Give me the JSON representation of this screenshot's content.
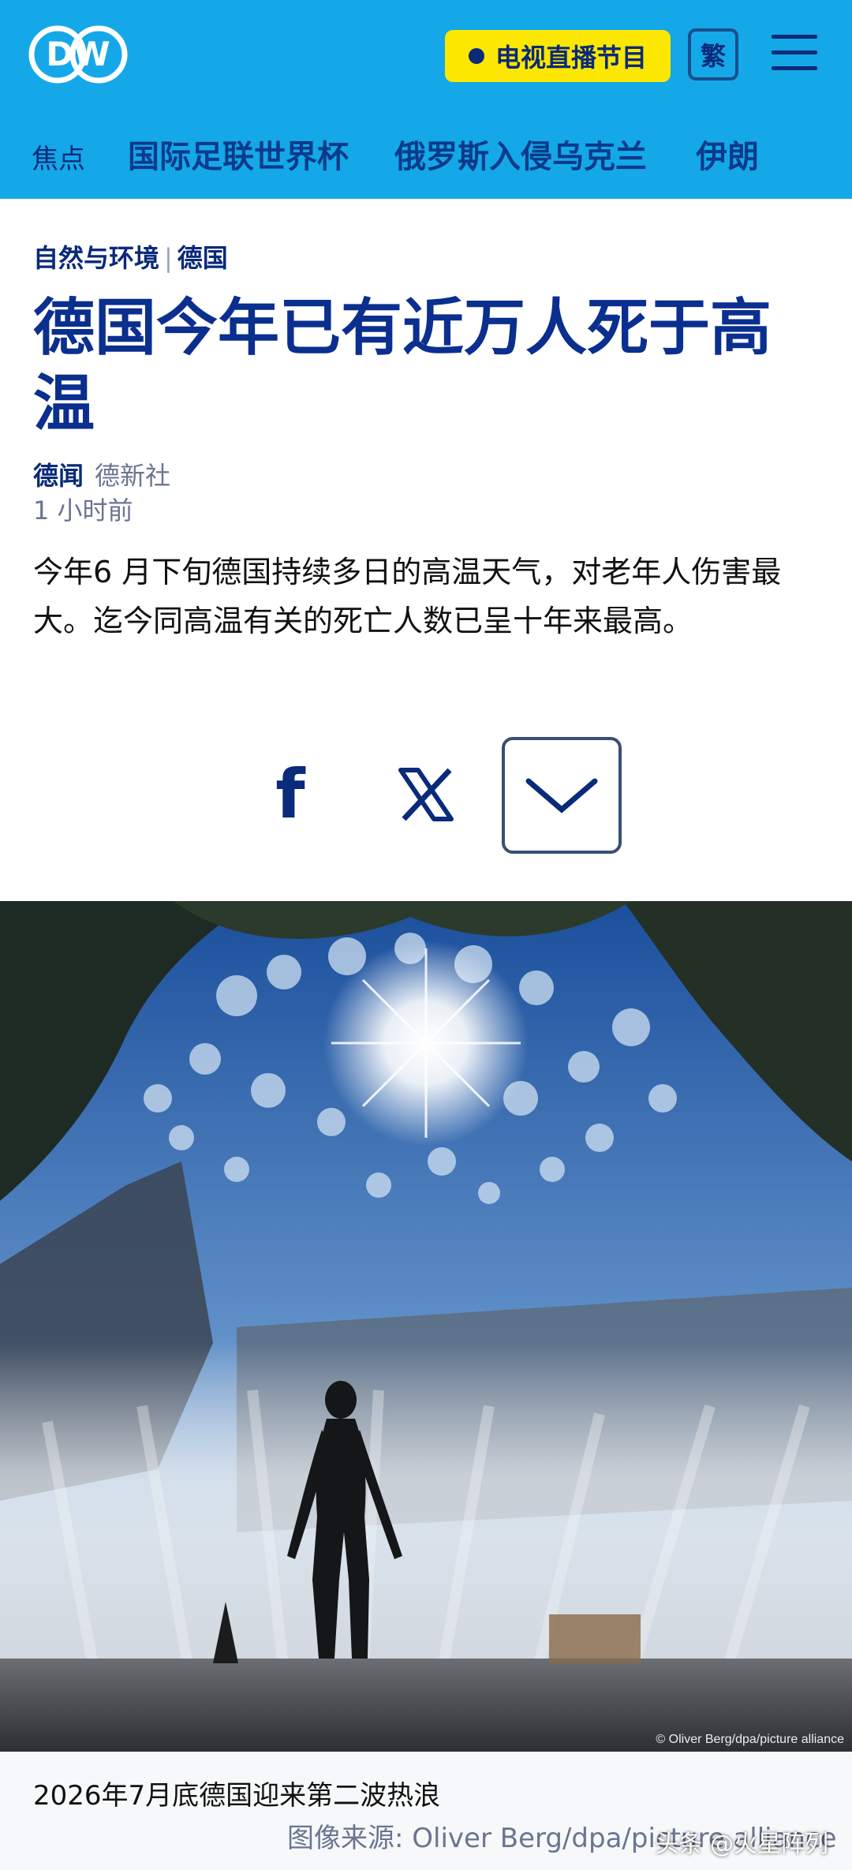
{
  "header": {
    "logo_text": "DW",
    "live_label": "电视直播节目",
    "lang_label": "繁",
    "nav_focus": "焦点",
    "nav_items": [
      "国际足联世界杯",
      "俄罗斯入侵乌克兰",
      "伊朗"
    ]
  },
  "article": {
    "category": "自然与环境",
    "region": "德国",
    "title": "德国今年已有近万人死于高温",
    "source_bold": "德闻",
    "source_agency": "德新社",
    "time": "1 小时前",
    "lead": "今年6 月下旬德国持续多日的高温天气，对老年人伤害最大。迄今同高温有关的死亡人数已呈十年来最高。"
  },
  "share": {
    "facebook_glyph": "f",
    "x_icon": "x-icon",
    "more_icon": "chevron-down-icon"
  },
  "photo": {
    "overlay_credit": "© Oliver Berg/dpa/picture alliance",
    "caption": "2026年7月底德国迎来第二波热浪",
    "credit": "图像来源: Oliver Berg/dpa/picture alliance"
  },
  "watermark": "头条 @火星阵列",
  "colors": {
    "header_bg": "#14A8E8",
    "live_bg": "#FBE700",
    "title": "#0A2F8F",
    "nav": "#0A3A8A"
  }
}
